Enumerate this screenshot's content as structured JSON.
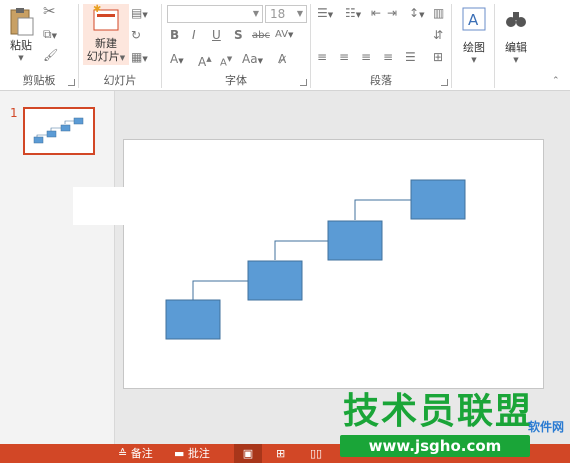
{
  "ribbon": {
    "clipboard": {
      "label": "剪贴板",
      "paste_label": "粘贴"
    },
    "slides": {
      "label": "幻灯片",
      "new_slide_line1": "新建",
      "new_slide_line2": "幻灯片"
    },
    "font": {
      "label": "字体",
      "font_name_value": "",
      "font_size_value": "18"
    },
    "paragraph": {
      "label": "段落"
    },
    "drawing": {
      "label": "绘图"
    },
    "editing": {
      "label": "编辑"
    }
  },
  "thumbnails": {
    "items": [
      {
        "number": "1"
      }
    ]
  },
  "statusbar": {
    "notes_label": "备注",
    "comments_label": "批注"
  },
  "watermark": {
    "title": "技术员联盟",
    "url": "www.jsgho.com",
    "side": "软件网"
  },
  "colors": {
    "accent": "#d24726",
    "shape_fill": "#5b9bd5",
    "shape_border": "#41719c",
    "watermark_green": "#1aa538"
  }
}
